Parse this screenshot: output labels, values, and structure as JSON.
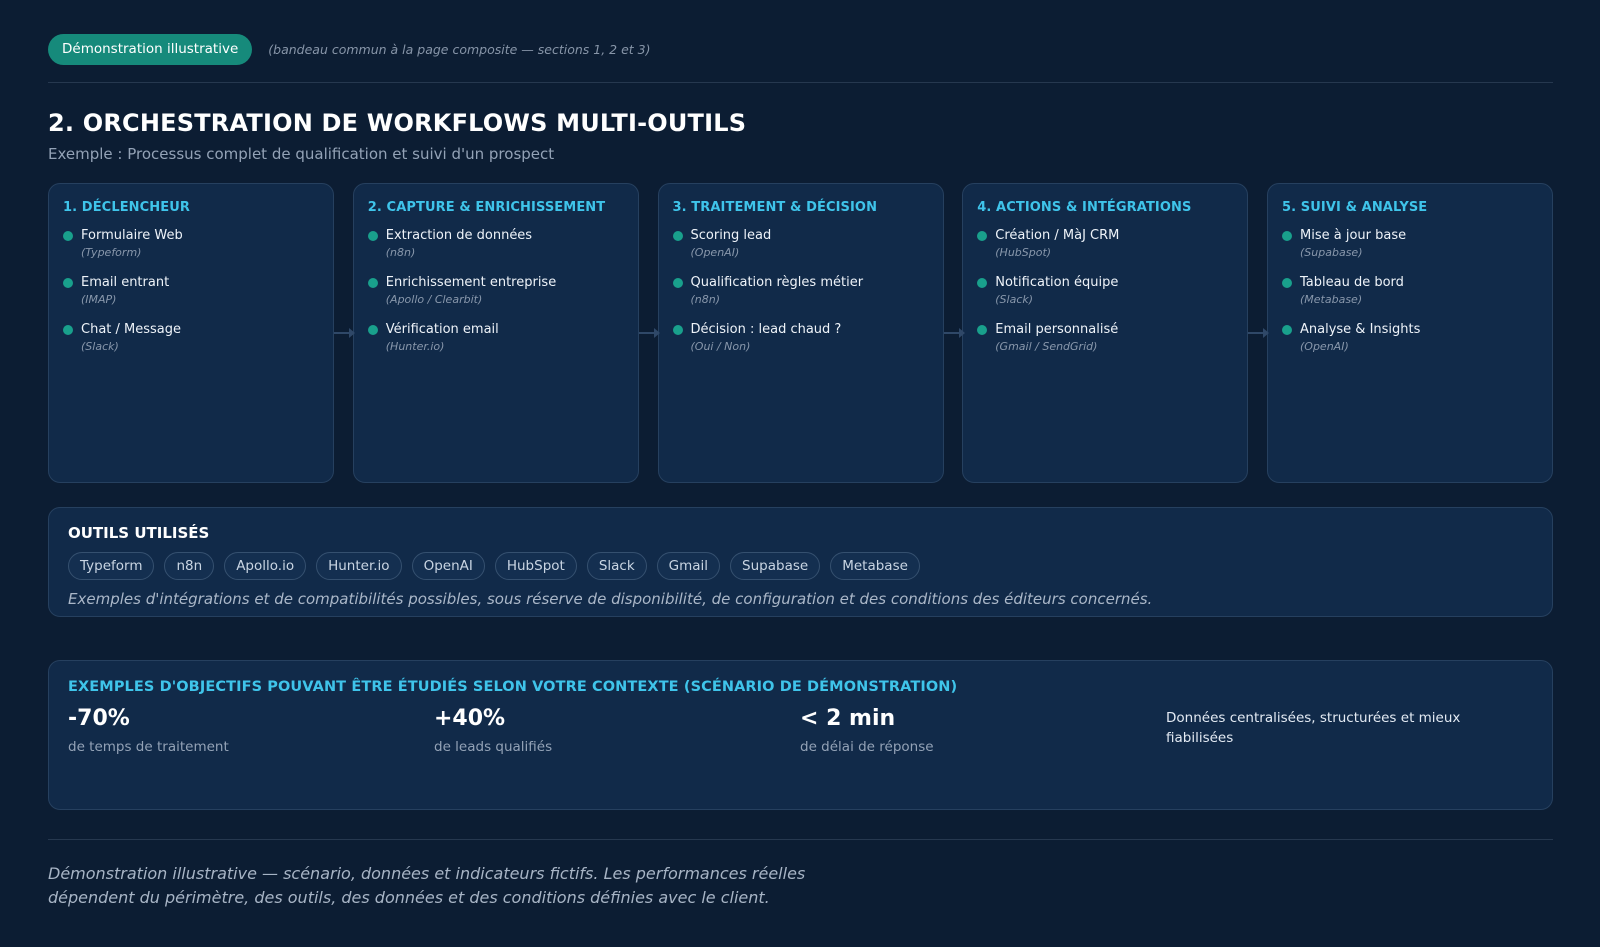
{
  "banner": {
    "badge": "Démonstration illustrative",
    "note": "(bandeau commun à la page composite — sections 1, 2 et 3)"
  },
  "header": {
    "title": "2. ORCHESTRATION DE WORKFLOWS MULTI-OUTILS",
    "subtitle": "Exemple : Processus complet de qualification et suivi d'un prospect"
  },
  "steps": [
    {
      "title": "1. DÉCLENCHEUR",
      "items": [
        {
          "label": "Formulaire Web",
          "tool": "(Typeform)"
        },
        {
          "label": "Email entrant",
          "tool": "(IMAP)"
        },
        {
          "label": "Chat / Message",
          "tool": "(Slack)"
        }
      ]
    },
    {
      "title": "2. CAPTURE & ENRICHISSEMENT",
      "items": [
        {
          "label": "Extraction de données",
          "tool": "(n8n)"
        },
        {
          "label": "Enrichissement entreprise",
          "tool": "(Apollo / Clearbit)"
        },
        {
          "label": "Vérification email",
          "tool": "(Hunter.io)"
        }
      ]
    },
    {
      "title": "3. TRAITEMENT & DÉCISION",
      "items": [
        {
          "label": "Scoring lead",
          "tool": "(OpenAI)"
        },
        {
          "label": "Qualification règles métier",
          "tool": "(n8n)"
        },
        {
          "label": "Décision : lead chaud ?",
          "tool": "(Oui / Non)"
        }
      ]
    },
    {
      "title": "4. ACTIONS & INTÉGRATIONS",
      "items": [
        {
          "label": "Création / MàJ CRM",
          "tool": "(HubSpot)"
        },
        {
          "label": "Notification équipe",
          "tool": "(Slack)"
        },
        {
          "label": "Email personnalisé",
          "tool": "(Gmail / SendGrid)"
        }
      ]
    },
    {
      "title": "5. SUIVI & ANALYSE",
      "items": [
        {
          "label": "Mise à jour base",
          "tool": "(Supabase)"
        },
        {
          "label": "Tableau de bord",
          "tool": "(Metabase)"
        },
        {
          "label": "Analyse & Insights",
          "tool": "(OpenAI)"
        }
      ]
    }
  ],
  "tools": {
    "title": "OUTILS UTILISÉS",
    "chips": [
      "Typeform",
      "n8n",
      "Apollo.io",
      "Hunter.io",
      "OpenAI",
      "HubSpot",
      "Slack",
      "Gmail",
      "Supabase",
      "Metabase"
    ],
    "note": "Exemples d'intégrations et de compatibilités possibles, sous réserve de disponibilité, de configuration et des conditions des éditeurs concernés."
  },
  "goals": {
    "title": "EXEMPLES D'OBJECTIFS POUVANT ÊTRE ÉTUDIÉS SELON VOTRE CONTEXTE (SCÉNARIO DE DÉMONSTRATION)",
    "items": [
      {
        "value": "-70%",
        "desc": "de temps de traitement"
      },
      {
        "value": "+40%",
        "desc": "de leads qualifiés"
      },
      {
        "value": "< 2 min",
        "desc": "de délai de réponse"
      }
    ],
    "text": "Données centralisées, structurées et mieux fiabilisées"
  },
  "footer": {
    "line1": "Démonstration illustrative — scénario, données et indicateurs fictifs. Les performances réelles",
    "line2": "dépendent du périmètre, des outils, des données et des conditions définies avec le client."
  },
  "colors": {
    "background": "#0c1d33",
    "card": "#112a49",
    "accent_cyan": "#3fc4ea",
    "accent_teal": "#168a7b"
  }
}
